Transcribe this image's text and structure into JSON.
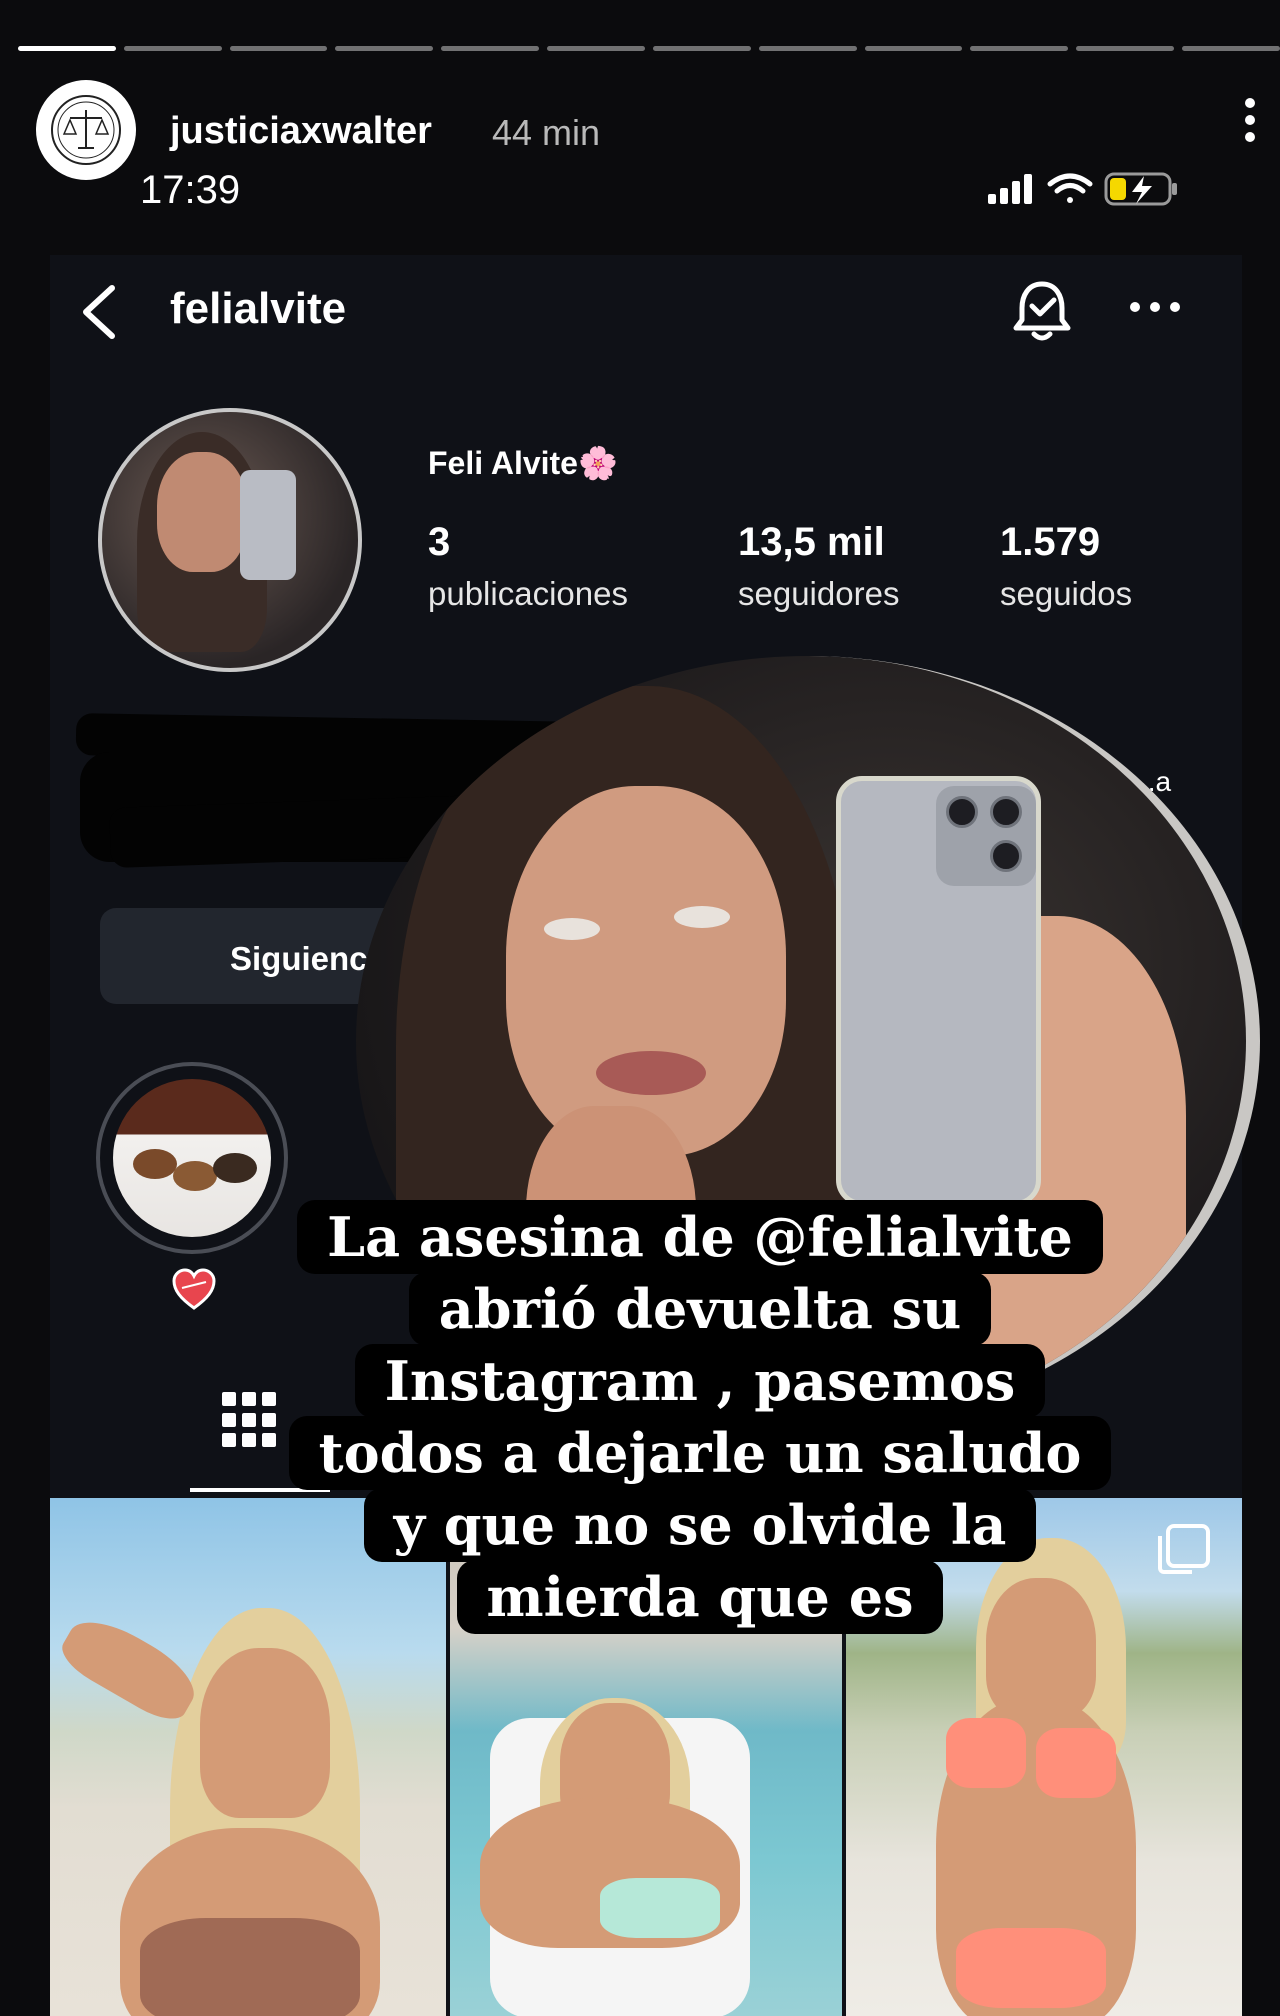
{
  "story": {
    "segments_total": 12,
    "segments_done": 1,
    "username": "justiciaxwalter",
    "time_ago": "44 min",
    "avatar_icon": "scales-of-justice-icon"
  },
  "status_bar": {
    "time": "17:39",
    "icons": [
      "signal-icon",
      "wifi-icon",
      "battery-charging-icon"
    ],
    "battery_color": "#f5d800"
  },
  "profile": {
    "handle": "felialvite",
    "display_name": "Feli Alvite🌸",
    "posts_count": "3",
    "posts_label": "publicaciones",
    "followers_count": "13,5 mil",
    "followers_label": "seguidores",
    "following_count": "1.579",
    "following_label": "seguidos",
    "bio_tail": "..a",
    "follow_button_label": "Siguienc"
  },
  "caption": {
    "lines": [
      "La asesina de @felialvite",
      "abrió devuelta su",
      "Instagram , pasemos",
      "todos a dejarle un saludo",
      "y que no se olvide la",
      "mierda que es"
    ]
  },
  "colors": {
    "background": "#0b0b0d",
    "inner_background": "#0f1117",
    "caption_bg": "#000000",
    "heart": "#e8454e"
  }
}
